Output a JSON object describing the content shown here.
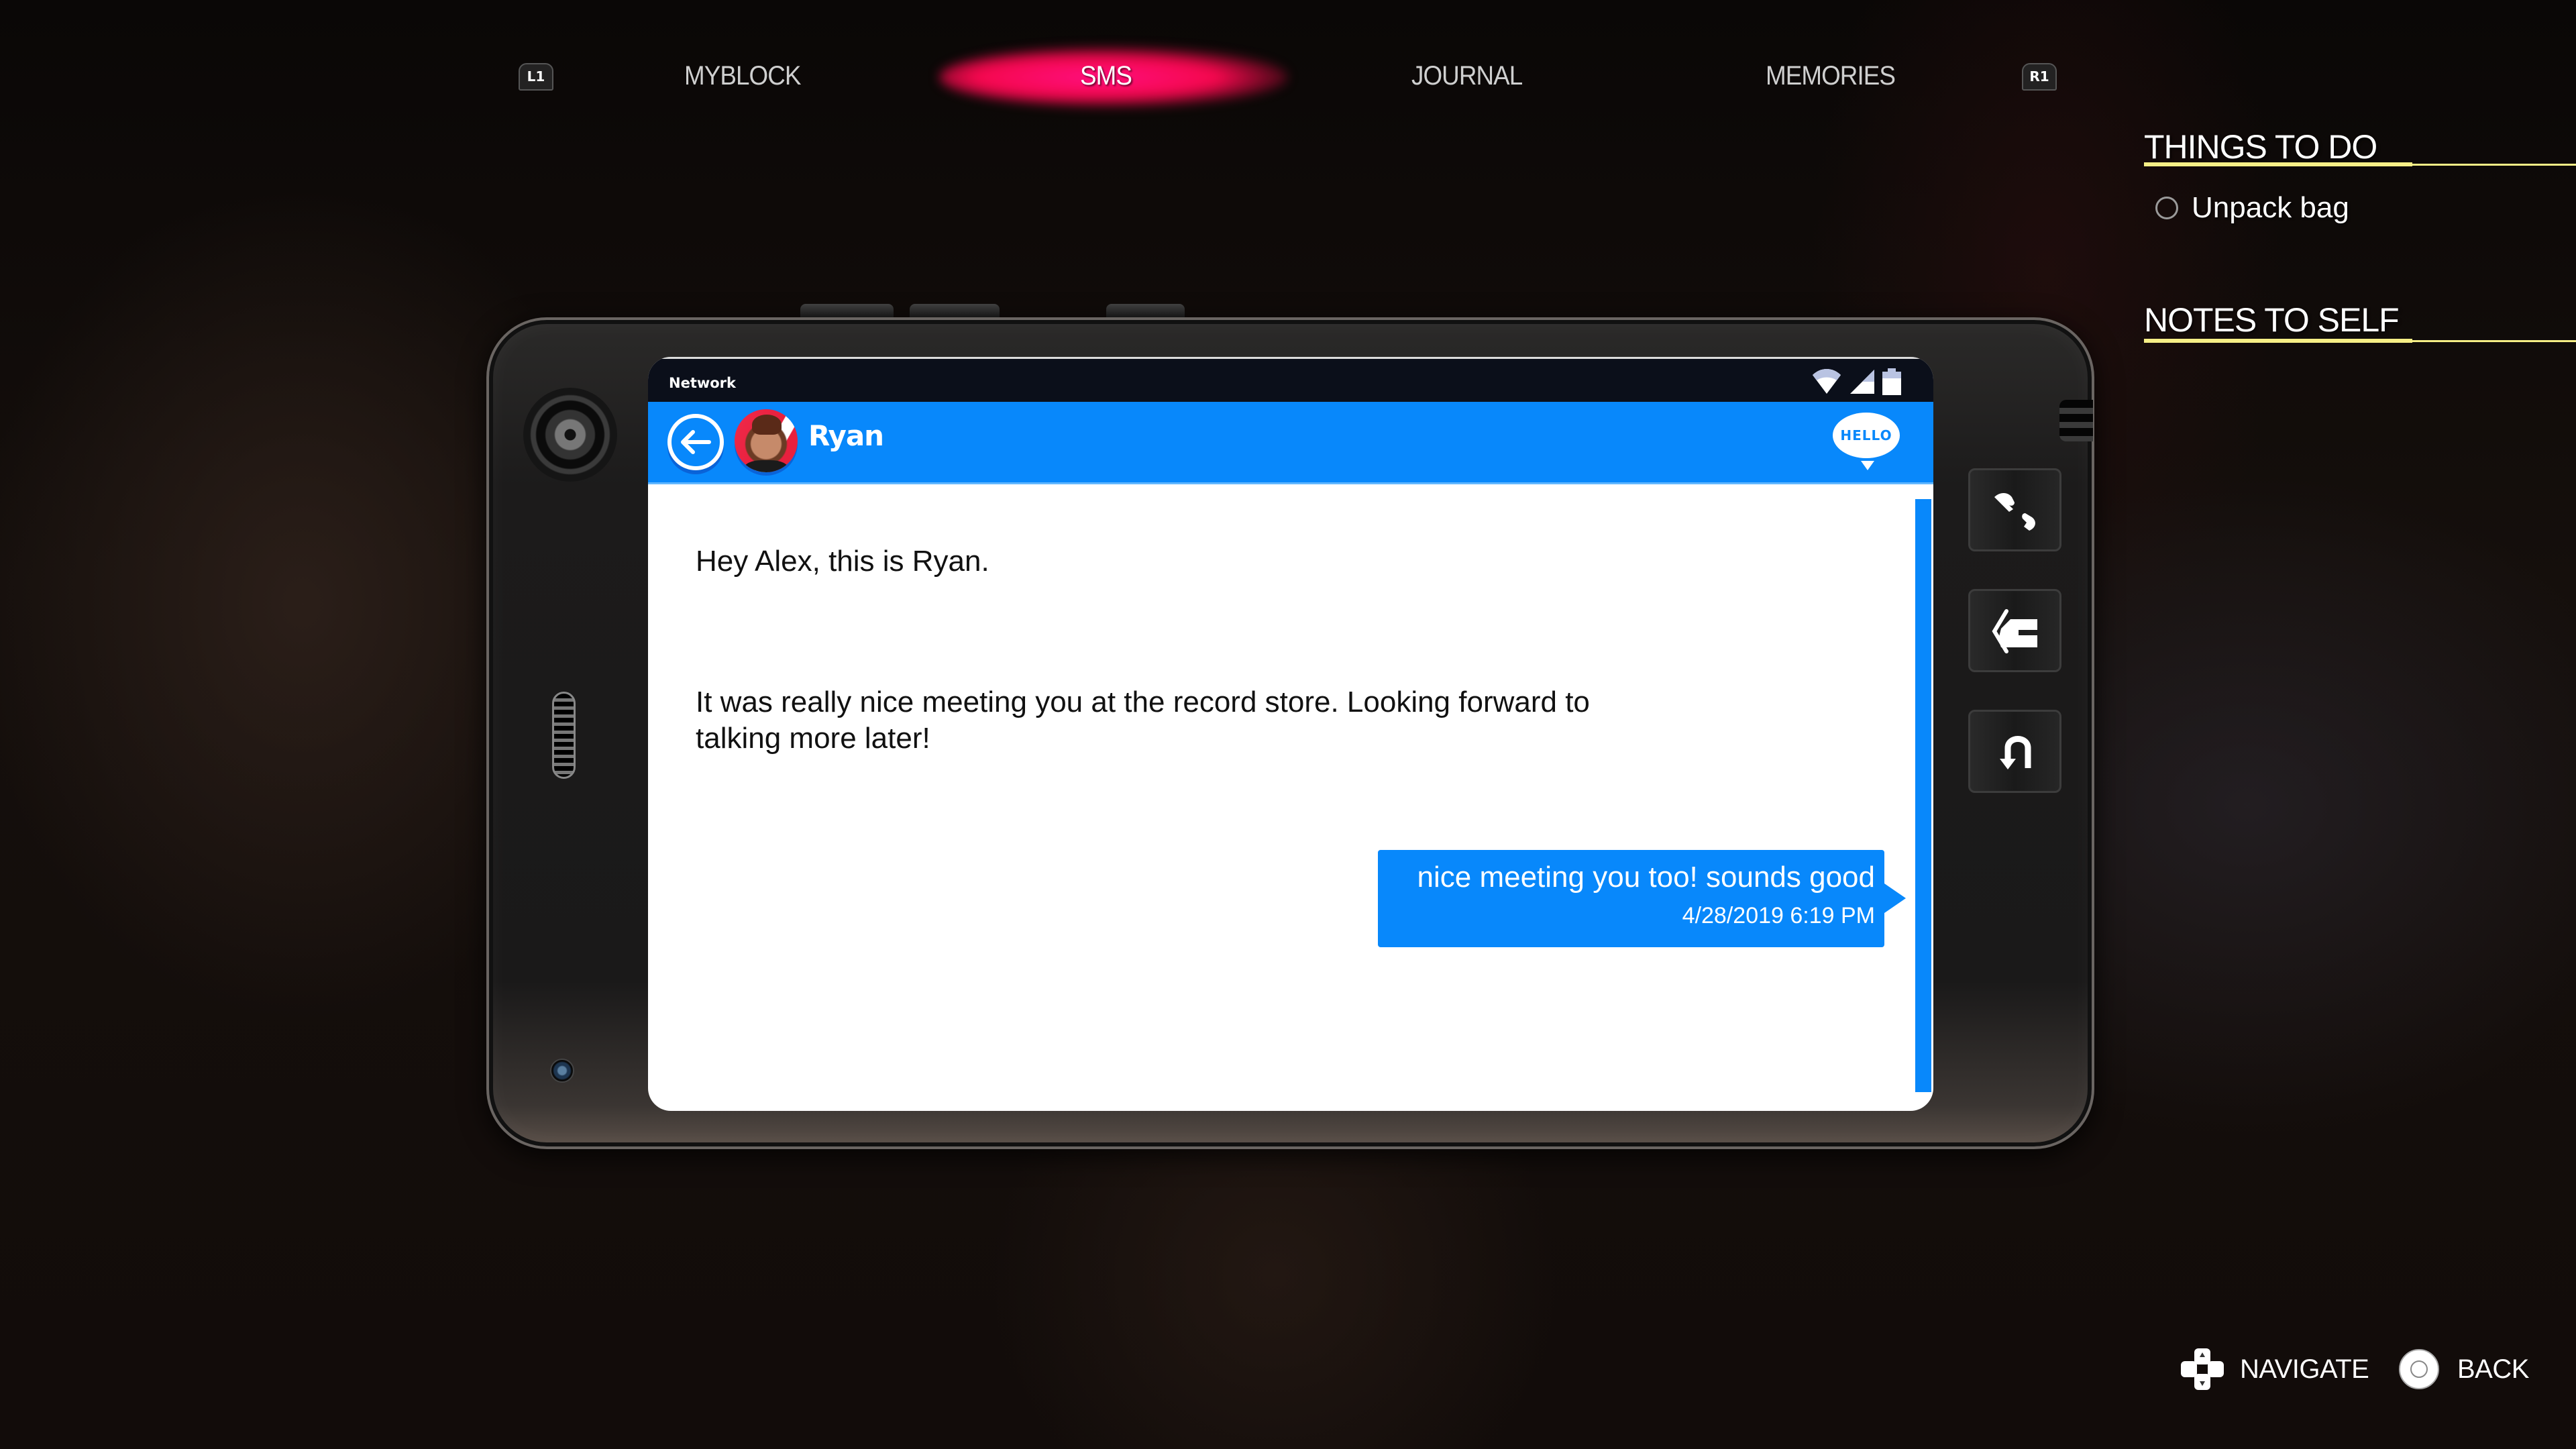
{
  "nav": {
    "left_shoulder": "L1",
    "right_shoulder": "R1",
    "tabs": [
      {
        "label": "MYBLOCK",
        "active": false
      },
      {
        "label": "SMS",
        "active": true
      },
      {
        "label": "JOURNAL",
        "active": false
      },
      {
        "label": "MEMORIES",
        "active": false
      }
    ]
  },
  "side_panel": {
    "things_to_do_title": "THINGS TO DO",
    "todos": [
      {
        "label": "Unpack bag",
        "done": false
      }
    ],
    "notes_title": "NOTES TO SELF"
  },
  "phone": {
    "status_bar": {
      "network_label": "Network",
      "icons": [
        "wifi-icon",
        "signal-icon",
        "battery-icon"
      ]
    },
    "header": {
      "contact_name": "Ryan",
      "sticker_label": "HELLO"
    },
    "messages": [
      {
        "from": "Ryan",
        "text": "Hey Alex, this is Ryan."
      },
      {
        "from": "Ryan",
        "text": "It was really nice meeting you at the record store. Looking forward to talking more later!"
      },
      {
        "from": "Alex",
        "text": "nice meeting you too! sounds good",
        "timestamp": "4/28/2019 6:19 PM"
      }
    ],
    "hardware_buttons": [
      "phone-call-icon",
      "home-icon",
      "undo-icon"
    ]
  },
  "hints": {
    "navigate_label": "NAVIGATE",
    "back_label": "BACK"
  },
  "colors": {
    "accent_blue": "#0888fb",
    "sms_glow": "#ff0f60",
    "panel_rule": "#f6ef86"
  }
}
